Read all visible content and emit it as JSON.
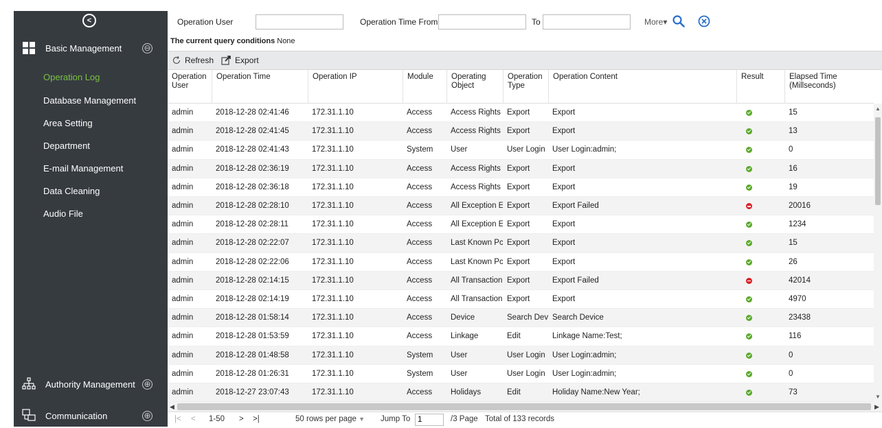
{
  "sidebar": {
    "modules": {
      "basic": {
        "label": "Basic Management",
        "toggle": "⊖"
      },
      "authority": {
        "label": "Authority Management",
        "toggle": "⊕"
      },
      "communication": {
        "label": "Communication",
        "toggle": "⊕"
      }
    },
    "items": [
      {
        "label": "Operation Log",
        "active": true
      },
      {
        "label": "Database Management"
      },
      {
        "label": "Area Setting"
      },
      {
        "label": "Department"
      },
      {
        "label": "E-mail Management"
      },
      {
        "label": "Data Cleaning"
      },
      {
        "label": "Audio File"
      }
    ],
    "accent_color": "#7ac143"
  },
  "filters": {
    "operation_user_label": "Operation User",
    "operation_user_value": "",
    "time_from_label": "Operation Time From",
    "time_from_value": "",
    "to_label": "To",
    "to_value": "",
    "more_label": "More▾"
  },
  "conditions": {
    "label": "The current query conditions",
    "value": "None"
  },
  "toolbar": {
    "refresh_label": "Refresh",
    "export_label": "Export"
  },
  "table": {
    "headers": [
      "Operation User",
      "Operation Time",
      "Operation IP",
      "Module",
      "Operating Object",
      "Operation Type",
      "Operation Content",
      "Result",
      "Elapsed Time (Millseconds)"
    ],
    "rows": [
      [
        "admin",
        "2018-12-28 02:41:46",
        "172.31.1.10",
        "Access",
        "Access Rights",
        "Export",
        "Export",
        "ok",
        "15"
      ],
      [
        "admin",
        "2018-12-28 02:41:45",
        "172.31.1.10",
        "Access",
        "Access Rights",
        "Export",
        "Export",
        "ok",
        "13"
      ],
      [
        "admin",
        "2018-12-28 02:41:43",
        "172.31.1.10",
        "System",
        "User",
        "User Login",
        "User Login:admin;",
        "ok",
        "0"
      ],
      [
        "admin",
        "2018-12-28 02:36:19",
        "172.31.1.10",
        "Access",
        "Access Rights",
        "Export",
        "Export",
        "ok",
        "16"
      ],
      [
        "admin",
        "2018-12-28 02:36:18",
        "172.31.1.10",
        "Access",
        "Access Rights",
        "Export",
        "Export",
        "ok",
        "19"
      ],
      [
        "admin",
        "2018-12-28 02:28:10",
        "172.31.1.10",
        "Access",
        "All Exception E",
        "Export",
        "Export Failed",
        "fail",
        "20016"
      ],
      [
        "admin",
        "2018-12-28 02:28:11",
        "172.31.1.10",
        "Access",
        "All Exception E",
        "Export",
        "Export",
        "ok",
        "1234"
      ],
      [
        "admin",
        "2018-12-28 02:22:07",
        "172.31.1.10",
        "Access",
        "Last Known Pc",
        "Export",
        "Export",
        "ok",
        "15"
      ],
      [
        "admin",
        "2018-12-28 02:22:06",
        "172.31.1.10",
        "Access",
        "Last Known Pc",
        "Export",
        "Export",
        "ok",
        "26"
      ],
      [
        "admin",
        "2018-12-28 02:14:15",
        "172.31.1.10",
        "Access",
        "All Transaction",
        "Export",
        "Export Failed",
        "fail",
        "42014"
      ],
      [
        "admin",
        "2018-12-28 02:14:19",
        "172.31.1.10",
        "Access",
        "All Transaction",
        "Export",
        "Export",
        "ok",
        "4970"
      ],
      [
        "admin",
        "2018-12-28 01:58:14",
        "172.31.1.10",
        "Access",
        "Device",
        "Search Devi",
        "Search Device",
        "ok",
        "23438"
      ],
      [
        "admin",
        "2018-12-28 01:53:59",
        "172.31.1.10",
        "Access",
        "Linkage",
        "Edit",
        "Linkage Name:Test;",
        "ok",
        "116"
      ],
      [
        "admin",
        "2018-12-28 01:48:58",
        "172.31.1.10",
        "System",
        "User",
        "User Login",
        "User Login:admin;",
        "ok",
        "0"
      ],
      [
        "admin",
        "2018-12-28 01:26:31",
        "172.31.1.10",
        "System",
        "User",
        "User Login",
        "User Login:admin;",
        "ok",
        "0"
      ],
      [
        "admin",
        "2018-12-27 23:07:43",
        "172.31.1.10",
        "Access",
        "Holidays",
        "Edit",
        "Holiday Name:New Year;",
        "ok",
        "73"
      ]
    ],
    "status_colors": {
      "ok": "#5aaa2a",
      "fail": "#d9242a"
    }
  },
  "pager": {
    "first": "|<",
    "prev": "<",
    "range": "1-50",
    "next": ">",
    "last": ">|",
    "rows_per_page": "50 rows per page",
    "jump_label": "Jump To",
    "jump_value": "1",
    "pages": "/3 Page",
    "total": "Total of 133 records"
  }
}
